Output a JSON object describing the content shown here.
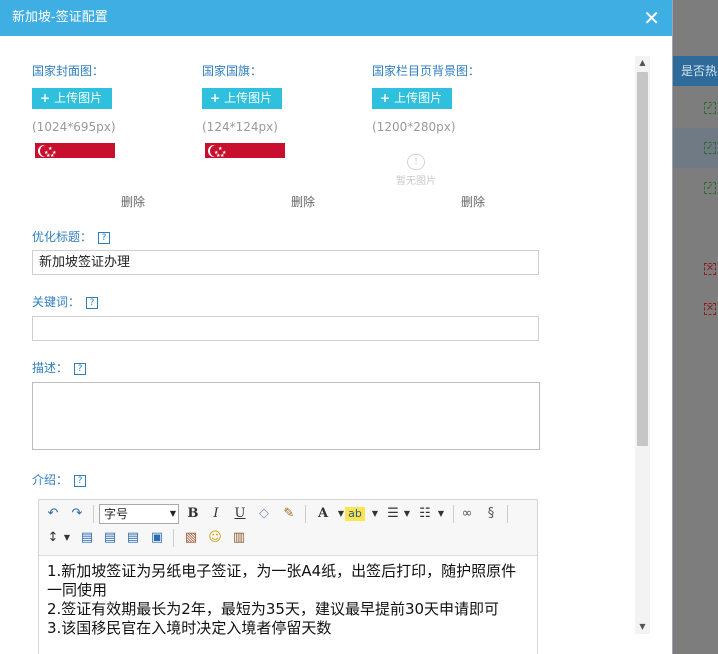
{
  "background": {
    "column_header": "是否热门"
  },
  "dialog": {
    "title": "新加坡-签证配置",
    "close_icon": "close-icon"
  },
  "uploads": [
    {
      "label": "国家封面图：",
      "button": "上传图片",
      "size": "(1024*695px)",
      "delete": "删除",
      "image": "singapore-flag"
    },
    {
      "label": "国家国旗：",
      "button": "上传图片",
      "size": "(124*124px)",
      "delete": "删除",
      "image": "singapore-flag"
    },
    {
      "label": "国家栏目页背景图：",
      "button": "上传图片",
      "size": "(1200*280px)",
      "delete": "删除",
      "image": "no-image",
      "noimage_text": "暂无图片"
    }
  ],
  "fields": {
    "title_label": "优化标题：",
    "title_value": "新加坡签证办理",
    "keywords_label": "关键词：",
    "keywords_value": "",
    "description_label": "描述：",
    "description_value": "",
    "intro_label": "介绍：",
    "help": "?"
  },
  "editor": {
    "font_size_select": "字号",
    "toolbar_icons": [
      "undo-icon",
      "redo-icon",
      "bold-icon",
      "italic-icon",
      "underline-icon",
      "eraser-icon",
      "format-brush-icon",
      "font-color-icon",
      "highlight-icon",
      "ordered-list-icon",
      "unordered-list-icon",
      "link-icon",
      "unlink-icon",
      "line-height-icon",
      "align-left-icon",
      "align-center-icon",
      "align-right-icon",
      "align-justify-icon",
      "image-icon",
      "emoji-icon",
      "paste-icon"
    ],
    "bold": "B",
    "italic": "I",
    "underline": "U",
    "font_color": "A",
    "highlight": "ab",
    "content_lines": [
      "1.新加坡签证为另纸电子签证，为一张A4纸，出签后打印，随护照原件一同使用",
      "2.签证有效期最长为2年，最短为35天，建议最早提前30天申请即可",
      "3.该国移民官在入境时决定入境者停留天数"
    ]
  }
}
